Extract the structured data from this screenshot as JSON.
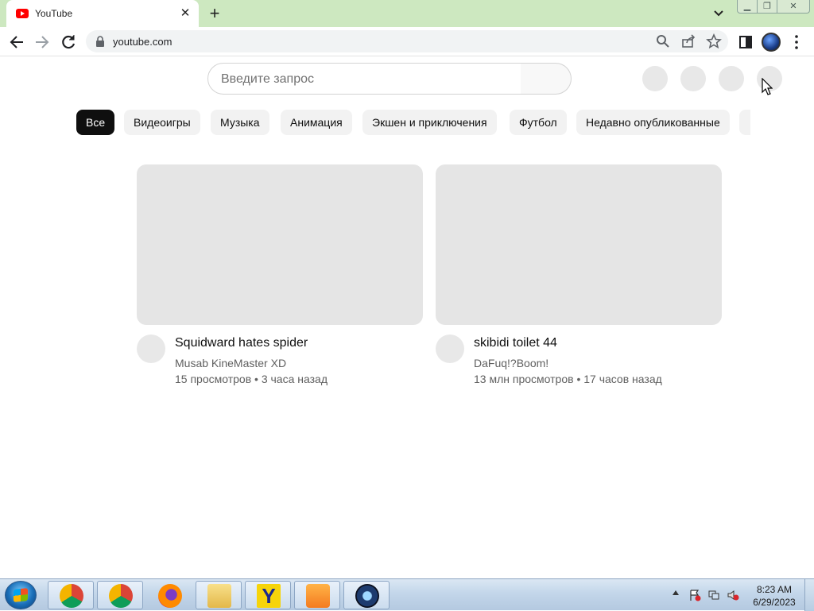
{
  "browser": {
    "tab": {
      "title": "YouTube",
      "favicon": "youtube-icon"
    },
    "url": "youtube.com",
    "accent": "#cde8c0"
  },
  "youtube": {
    "search_placeholder": "Введите запрос",
    "chips": [
      "Все",
      "Видеоигры",
      "Музыка",
      "Анимация",
      "Экшен и приключения",
      "Футбол",
      "Недавно опубликованные"
    ],
    "active_chip": "Все",
    "videos": [
      {
        "title": "Squidward hates spider",
        "channel": "Musab KineMaster XD",
        "meta": "15 просмотров • 3 часа назад"
      },
      {
        "title": "skibidi toilet 44",
        "channel": "DaFuq!?Boom!",
        "meta": "13 млн просмотров • 17 часов назад"
      }
    ]
  },
  "taskbar": {
    "apps": [
      "chrome-icon",
      "chrome-profile-icon",
      "firefox-icon",
      "file-explorer-icon",
      "yandex-icon",
      "media-player-icon",
      "camera-icon"
    ],
    "clock": {
      "time": "8:23 AM",
      "date": "6/29/2023"
    }
  }
}
